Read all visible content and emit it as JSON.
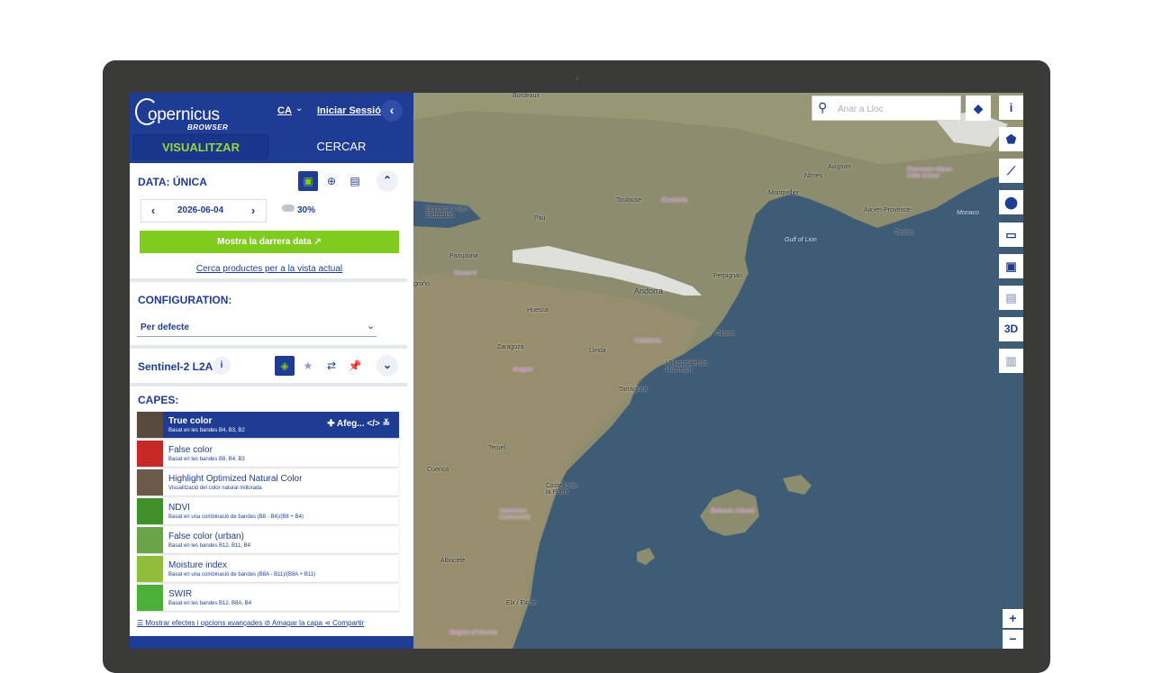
{
  "header": {
    "logo_text": "opernicus",
    "logo_sub": "BROWSER",
    "lang": "CA",
    "login": "Iniciar Sessió",
    "collapse_glyph": "‹"
  },
  "tabs": {
    "visualize": "VISUALITZAR",
    "search": "CERCAR"
  },
  "date_section": {
    "title": "DATA: ÚNICA",
    "date": "2026-06-04",
    "cloud": "30%",
    "latest_button": "Mostra la darrera data ↗",
    "search_link": "Cerca productes per a la vista actual"
  },
  "configuration": {
    "title": "CONFIGURATION:",
    "value": "Per defecte"
  },
  "dataset": {
    "name": "Sentinel-2 L2A",
    "info": "i"
  },
  "layers_title": "CAPES:",
  "layers": [
    {
      "name": "True color",
      "desc": "Basat en les bandes B4, B3, B2",
      "active": true,
      "actions": "✚ Afeg...   </>   ≚",
      "color": "#5a4a3e"
    },
    {
      "name": "False color",
      "desc": "Basat en les bandes B8, B4, B3",
      "active": false,
      "color": "#c62828"
    },
    {
      "name": "Highlight Optimized Natural Color",
      "desc": "Visualització del color natural millorada",
      "active": false,
      "color": "#6b5a4a"
    },
    {
      "name": "NDVI",
      "desc": "Basat en una combinació de bandes (B8 - B4)/(B8 + B4)",
      "active": false,
      "color": "#3f8f2a"
    },
    {
      "name": "False color (urban)",
      "desc": "Basat en les bandes B12, B11, B4",
      "active": false,
      "color": "#6aa34a"
    },
    {
      "name": "Moisture index",
      "desc": "Basat en una combinació de bandes (B8A - B11)/(B8A + B11)",
      "active": false,
      "color": "#8fbf3a"
    },
    {
      "name": "SWIR",
      "desc": "Basat en les bandes B12, B8A, B4",
      "active": false,
      "color": "#4caf3a"
    }
  ],
  "bottom_links": "☰ Mostrar efectes i opcions avançades     ⊘ Amagar la capa     ⋖ Compartir",
  "map": {
    "search_placeholder": "Anar a Lloc",
    "labels": {
      "bordeaux": "Bordeaux",
      "toulouse": "Toulouse",
      "occitania": "Occitania",
      "montpellier": "Montpellier",
      "nimes": "Nîmes",
      "avignon": "Avignon",
      "provence": "Provence-Alpes-Côte d'Azur",
      "aix": "Aix-en-Provence",
      "toulon": "Toulon",
      "monaco": "Monaco",
      "perpignan": "Perpignan",
      "andorra": "Andorra",
      "gulf": "Gulf of Lion",
      "pau": "Pau",
      "donostia": "Donostia / San Sebastián",
      "pamplona": "Pamplona",
      "navarre": "Navarre",
      "huesca": "Huesca",
      "zaragoza": "Zaragoza",
      "aragon": "Aragon",
      "lleida": "Lleida",
      "catalonia": "Catalonia",
      "girona": "Girona",
      "hospitalet": "L'Hospitalet de Llobregat",
      "tarragona": "Tarragona",
      "teruel": "Teruel",
      "cuenca": "Cuenca",
      "castello": "Castelló de la Plana",
      "valencia": "Valencian Community",
      "balearic": "Balearic Islands",
      "albacete": "Albacete",
      "elx": "Elx / Elche",
      "murcia": "Region of Murcia",
      "grono": "groño"
    }
  },
  "tools": {
    "info": "i",
    "polygon": "⬟",
    "line": "⟋",
    "pin": "⬤",
    "ruler": "▭",
    "image": "▣",
    "film": "▤",
    "three_d": "3D",
    "chart": "▥"
  },
  "zoom": {
    "in": "+",
    "out": "−"
  },
  "colors": {
    "primary": "#1f3c94",
    "accent": "#7fcc1f"
  }
}
